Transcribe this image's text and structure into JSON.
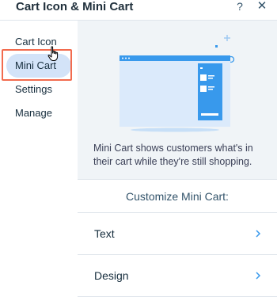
{
  "header": {
    "title": "Cart Icon & Mini Cart",
    "help_label": "?",
    "close_label": "✕"
  },
  "sidebar": {
    "items": [
      {
        "label": "Cart Icon",
        "selected": false
      },
      {
        "label": "Mini Cart",
        "selected": true
      },
      {
        "label": "Settings",
        "selected": false
      },
      {
        "label": "Manage",
        "selected": false
      }
    ]
  },
  "main": {
    "description": "Mini Cart shows customers what's in their cart while they're still shopping.",
    "section_title": "Customize Mini Cart:",
    "rows": [
      {
        "label": "Text"
      },
      {
        "label": "Design"
      }
    ]
  },
  "colors": {
    "accent": "#3899ec",
    "selected_bg": "#d3e3f8",
    "highlight": "#f26b4e",
    "panel_bg": "#f0f4f7"
  }
}
